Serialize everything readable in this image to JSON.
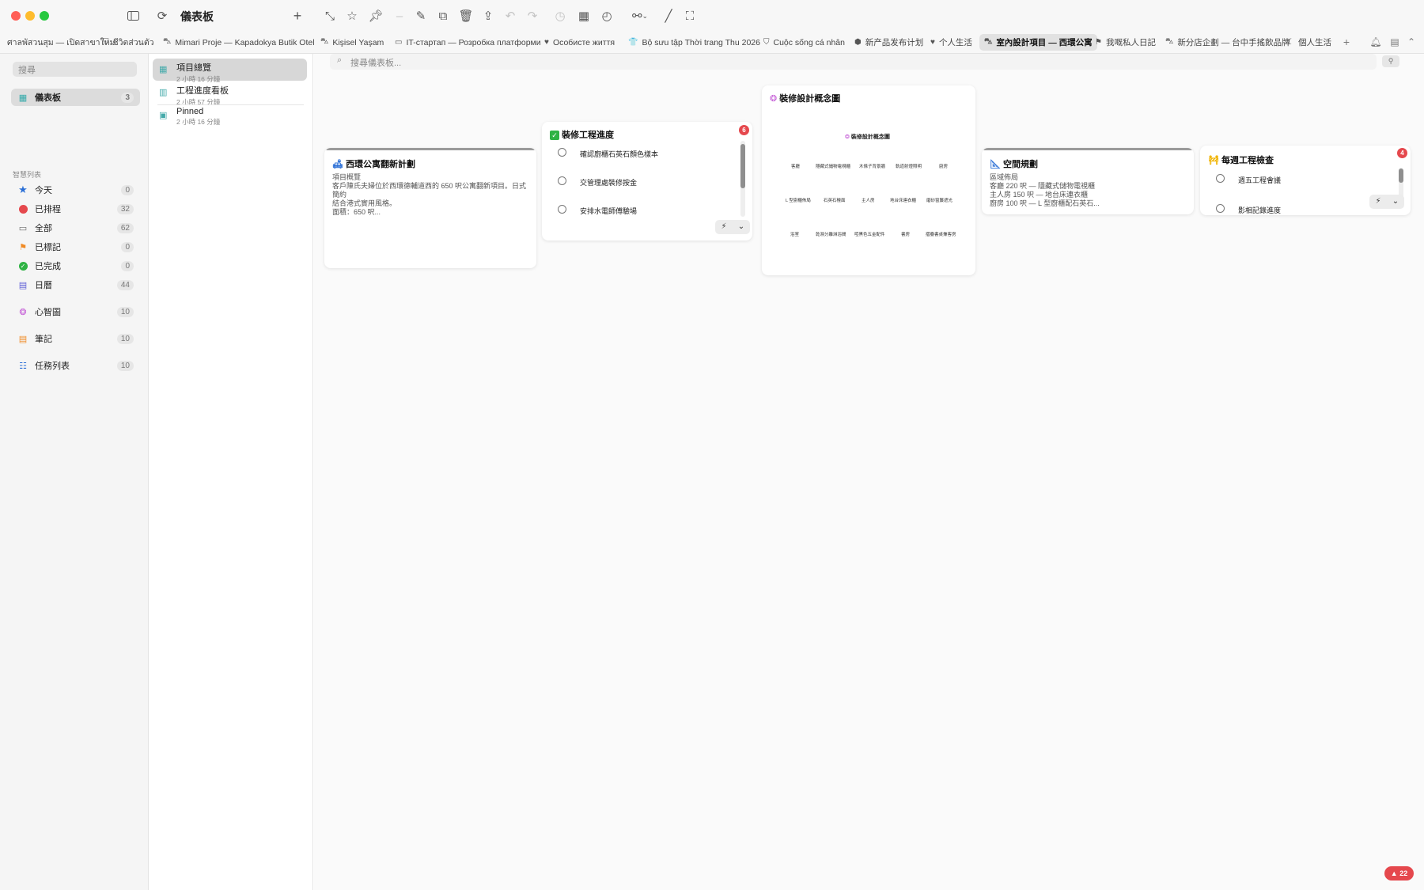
{
  "window": {
    "title": "儀表板"
  },
  "toolbar": {
    "more_label": "⌄"
  },
  "tabs": [
    {
      "label": "ศาลพัสวนสุม — เปิดสาขาใหม่",
      "icon": ""
    },
    {
      "label": "ชีวิตส่วนตัว",
      "icon": "⛉"
    },
    {
      "label": "Mimari Proje — Kapadokya Butik Otel",
      "icon": "⛍"
    },
    {
      "label": "Kişisel Yaşam",
      "icon": "⛍"
    },
    {
      "label": "IT-стартап — Розробка платформи",
      "icon": "▭"
    },
    {
      "label": "Особисте життя",
      "icon": "♥"
    },
    {
      "label": "Bộ sưu tập Thời trang Thu 2026",
      "icon": "👕"
    },
    {
      "label": "Cuộc sống cá nhân",
      "icon": "⛉"
    },
    {
      "label": "新产品发布计划",
      "icon": "⬢"
    },
    {
      "label": "个人生活",
      "icon": "♥"
    },
    {
      "label": "室內設計項目 — 西環公寓",
      "icon": "⛍"
    },
    {
      "label": "我嘅私人日記",
      "icon": "⚑"
    },
    {
      "label": "新分店企劃 — 台中手搖飲品牌",
      "icon": "⛍"
    },
    {
      "label": "個人生活",
      "icon": "☾"
    }
  ],
  "sidebar": {
    "search_placeholder": "搜尋",
    "section_label": "智慧列表",
    "dashboard": {
      "label": "儀表板",
      "count": "3"
    },
    "items": [
      {
        "label": "今天",
        "count": "0",
        "icon": "star-icon",
        "color": "#2b6fd6"
      },
      {
        "label": "已排程",
        "count": "32",
        "icon": "calendar-clock-icon",
        "color": "#e5484d"
      },
      {
        "label": "全部",
        "count": "62",
        "icon": "tray-icon",
        "color": "#6b6b6b"
      },
      {
        "label": "已標記",
        "count": "0",
        "icon": "flag-icon",
        "color": "#f08a24"
      },
      {
        "label": "已完成",
        "count": "0",
        "icon": "checkmark-icon",
        "color": "#2fb344"
      },
      {
        "label": "日曆",
        "count": "44",
        "icon": "calendar-icon",
        "color": "#5b5bd6"
      },
      {
        "label": "心智圖",
        "count": "10",
        "icon": "brain-icon",
        "color": "#c45bd6"
      },
      {
        "label": "筆記",
        "count": "10",
        "icon": "note-icon",
        "color": "#f08a24"
      },
      {
        "label": "任務列表",
        "count": "10",
        "icon": "list-icon",
        "color": "#2b6fd6"
      }
    ]
  },
  "dashboards": [
    {
      "title": "項目總覽",
      "subtitle": "2 小時 16 分鐘"
    },
    {
      "title": "工程進度看板",
      "subtitle": "2 小時 57 分鐘"
    },
    {
      "title": "Pinned",
      "subtitle": "2 小時 16 分鐘"
    }
  ],
  "main": {
    "search_placeholder": "搜尋儀表板..."
  },
  "cards": {
    "overview": {
      "title": "西環公寓翻新計劃",
      "line1": "項目概覽",
      "line2": "客戶陳氏夫婦位於西環德輔道西的 650 呎公寓翻新項目。日式簡約",
      "line3": "結合港式實用風格。",
      "line4": "面積：650 呎..."
    },
    "progress": {
      "title": "裝修工程進度",
      "badge": "6",
      "items": [
        "確認廚櫃石英石顏色樣本",
        "交管理處裝修按金",
        "安排水電師傅驗場"
      ]
    },
    "mindmap": {
      "title": "裝修設計概念圖",
      "root": "裝修設計概念圖",
      "row1": [
        "客廳",
        "隱藏式儲物電視櫃",
        "木條子背景牆",
        "軌道射燈照明",
        "廚房"
      ],
      "row2": [
        "L 型廚櫃佈局",
        "石英石檯面",
        "主人房",
        "地台床連衣櫃",
        "磨砂窗簾遮光"
      ],
      "row3": [
        "浴室",
        "乾濕分離淋浴間",
        "啞黑色五金配件",
        "書房",
        "摺疊書桌兼客房"
      ]
    },
    "space": {
      "title": "空間規劃",
      "line1": "區域佈局",
      "line2": "客廳 220 呎 — 隱藏式儲物電視櫃",
      "line3": "主人房 150 呎 — 地台床連衣櫃",
      "line4": "廚房 100 呎 — L 型廚櫃配石英石..."
    },
    "weekly": {
      "title": "每週工程檢查",
      "badge": "4",
      "items": [
        "週五工程會議",
        "影相記錄進度"
      ]
    }
  },
  "alert": {
    "count": "22"
  }
}
